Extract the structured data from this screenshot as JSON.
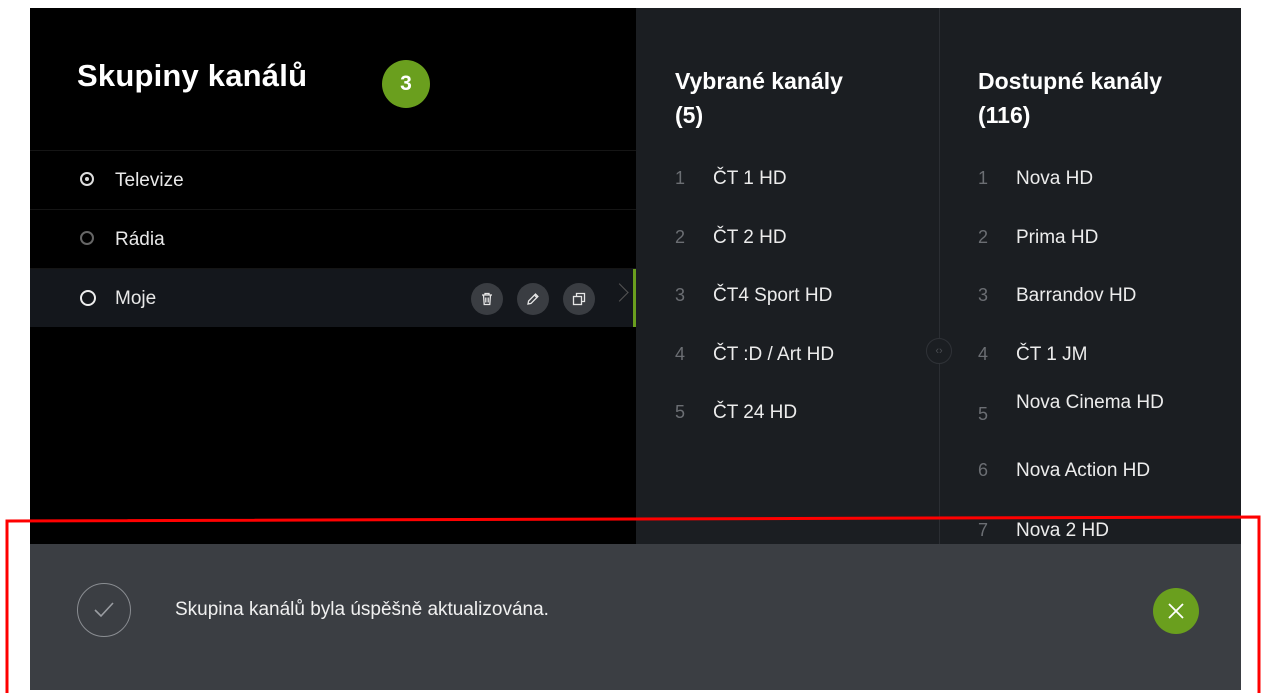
{
  "groups": {
    "title": "Skupiny kanálů",
    "count": "3",
    "items": [
      {
        "label": "Televize",
        "state": "checked"
      },
      {
        "label": "Rádia",
        "state": "unchecked"
      },
      {
        "label": "Moje",
        "state": "selected"
      }
    ],
    "actions": [
      {
        "icon": "trash-icon"
      },
      {
        "icon": "pencil-icon"
      },
      {
        "icon": "copy-icon"
      }
    ]
  },
  "selected_channels": {
    "title_line1": "Vybrané kanály",
    "title_line2": "(5)",
    "items": [
      {
        "num": "1",
        "name": "ČT 1 HD"
      },
      {
        "num": "2",
        "name": "ČT 2 HD"
      },
      {
        "num": "3",
        "name": "ČT4 Sport HD"
      },
      {
        "num": "4",
        "name": "ČT :D / Art HD"
      },
      {
        "num": "5",
        "name": "ČT 24 HD"
      }
    ]
  },
  "available_channels": {
    "title_line1": "Dostupné kanály",
    "title_line2": "(116)",
    "items": [
      {
        "num": "1",
        "name": "Nova HD"
      },
      {
        "num": "2",
        "name": "Prima HD"
      },
      {
        "num": "3",
        "name": "Barrandov HD"
      },
      {
        "num": "4",
        "name": "ČT 1 JM"
      },
      {
        "num": "5",
        "name": "Nova Cinema HD"
      },
      {
        "num": "6",
        "name": "Nova Action HD"
      },
      {
        "num": "7",
        "name": "Nova 2 HD"
      }
    ]
  },
  "toast": {
    "message": "Skupina kanálů byla úspěšně aktualizována.",
    "icon": "check-icon",
    "close_icon": "close-icon"
  },
  "colors": {
    "accent": "#6a9f1e",
    "background": "#000000",
    "column_bg": "#1b1e22",
    "toast_bg": "#3b3e43",
    "annotation": "#ff0000"
  }
}
